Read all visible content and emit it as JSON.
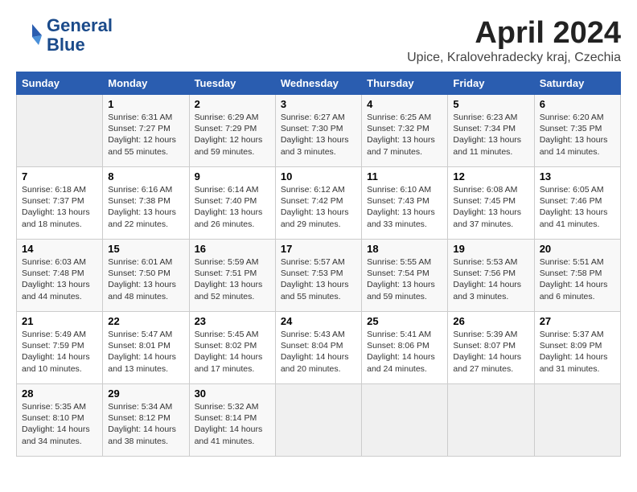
{
  "header": {
    "logo_line1": "General",
    "logo_line2": "Blue",
    "title": "April 2024",
    "location": "Upice, Kralovehradecky kraj, Czechia"
  },
  "days_of_week": [
    "Sunday",
    "Monday",
    "Tuesday",
    "Wednesday",
    "Thursday",
    "Friday",
    "Saturday"
  ],
  "weeks": [
    [
      {
        "day": "",
        "empty": true
      },
      {
        "day": "1",
        "sunrise": "6:31 AM",
        "sunset": "7:27 PM",
        "daylight": "12 hours and 55 minutes."
      },
      {
        "day": "2",
        "sunrise": "6:29 AM",
        "sunset": "7:29 PM",
        "daylight": "12 hours and 59 minutes."
      },
      {
        "day": "3",
        "sunrise": "6:27 AM",
        "sunset": "7:30 PM",
        "daylight": "13 hours and 3 minutes."
      },
      {
        "day": "4",
        "sunrise": "6:25 AM",
        "sunset": "7:32 PM",
        "daylight": "13 hours and 7 minutes."
      },
      {
        "day": "5",
        "sunrise": "6:23 AM",
        "sunset": "7:34 PM",
        "daylight": "13 hours and 11 minutes."
      },
      {
        "day": "6",
        "sunrise": "6:20 AM",
        "sunset": "7:35 PM",
        "daylight": "13 hours and 14 minutes."
      }
    ],
    [
      {
        "day": "7",
        "sunrise": "6:18 AM",
        "sunset": "7:37 PM",
        "daylight": "13 hours and 18 minutes."
      },
      {
        "day": "8",
        "sunrise": "6:16 AM",
        "sunset": "7:38 PM",
        "daylight": "13 hours and 22 minutes."
      },
      {
        "day": "9",
        "sunrise": "6:14 AM",
        "sunset": "7:40 PM",
        "daylight": "13 hours and 26 minutes."
      },
      {
        "day": "10",
        "sunrise": "6:12 AM",
        "sunset": "7:42 PM",
        "daylight": "13 hours and 29 minutes."
      },
      {
        "day": "11",
        "sunrise": "6:10 AM",
        "sunset": "7:43 PM",
        "daylight": "13 hours and 33 minutes."
      },
      {
        "day": "12",
        "sunrise": "6:08 AM",
        "sunset": "7:45 PM",
        "daylight": "13 hours and 37 minutes."
      },
      {
        "day": "13",
        "sunrise": "6:05 AM",
        "sunset": "7:46 PM",
        "daylight": "13 hours and 41 minutes."
      }
    ],
    [
      {
        "day": "14",
        "sunrise": "6:03 AM",
        "sunset": "7:48 PM",
        "daylight": "13 hours and 44 minutes."
      },
      {
        "day": "15",
        "sunrise": "6:01 AM",
        "sunset": "7:50 PM",
        "daylight": "13 hours and 48 minutes."
      },
      {
        "day": "16",
        "sunrise": "5:59 AM",
        "sunset": "7:51 PM",
        "daylight": "13 hours and 52 minutes."
      },
      {
        "day": "17",
        "sunrise": "5:57 AM",
        "sunset": "7:53 PM",
        "daylight": "13 hours and 55 minutes."
      },
      {
        "day": "18",
        "sunrise": "5:55 AM",
        "sunset": "7:54 PM",
        "daylight": "13 hours and 59 minutes."
      },
      {
        "day": "19",
        "sunrise": "5:53 AM",
        "sunset": "7:56 PM",
        "daylight": "14 hours and 3 minutes."
      },
      {
        "day": "20",
        "sunrise": "5:51 AM",
        "sunset": "7:58 PM",
        "daylight": "14 hours and 6 minutes."
      }
    ],
    [
      {
        "day": "21",
        "sunrise": "5:49 AM",
        "sunset": "7:59 PM",
        "daylight": "14 hours and 10 minutes."
      },
      {
        "day": "22",
        "sunrise": "5:47 AM",
        "sunset": "8:01 PM",
        "daylight": "14 hours and 13 minutes."
      },
      {
        "day": "23",
        "sunrise": "5:45 AM",
        "sunset": "8:02 PM",
        "daylight": "14 hours and 17 minutes."
      },
      {
        "day": "24",
        "sunrise": "5:43 AM",
        "sunset": "8:04 PM",
        "daylight": "14 hours and 20 minutes."
      },
      {
        "day": "25",
        "sunrise": "5:41 AM",
        "sunset": "8:06 PM",
        "daylight": "14 hours and 24 minutes."
      },
      {
        "day": "26",
        "sunrise": "5:39 AM",
        "sunset": "8:07 PM",
        "daylight": "14 hours and 27 minutes."
      },
      {
        "day": "27",
        "sunrise": "5:37 AM",
        "sunset": "8:09 PM",
        "daylight": "14 hours and 31 minutes."
      }
    ],
    [
      {
        "day": "28",
        "sunrise": "5:35 AM",
        "sunset": "8:10 PM",
        "daylight": "14 hours and 34 minutes."
      },
      {
        "day": "29",
        "sunrise": "5:34 AM",
        "sunset": "8:12 PM",
        "daylight": "14 hours and 38 minutes."
      },
      {
        "day": "30",
        "sunrise": "5:32 AM",
        "sunset": "8:14 PM",
        "daylight": "14 hours and 41 minutes."
      },
      {
        "day": "",
        "empty": true
      },
      {
        "day": "",
        "empty": true
      },
      {
        "day": "",
        "empty": true
      },
      {
        "day": "",
        "empty": true
      }
    ]
  ]
}
